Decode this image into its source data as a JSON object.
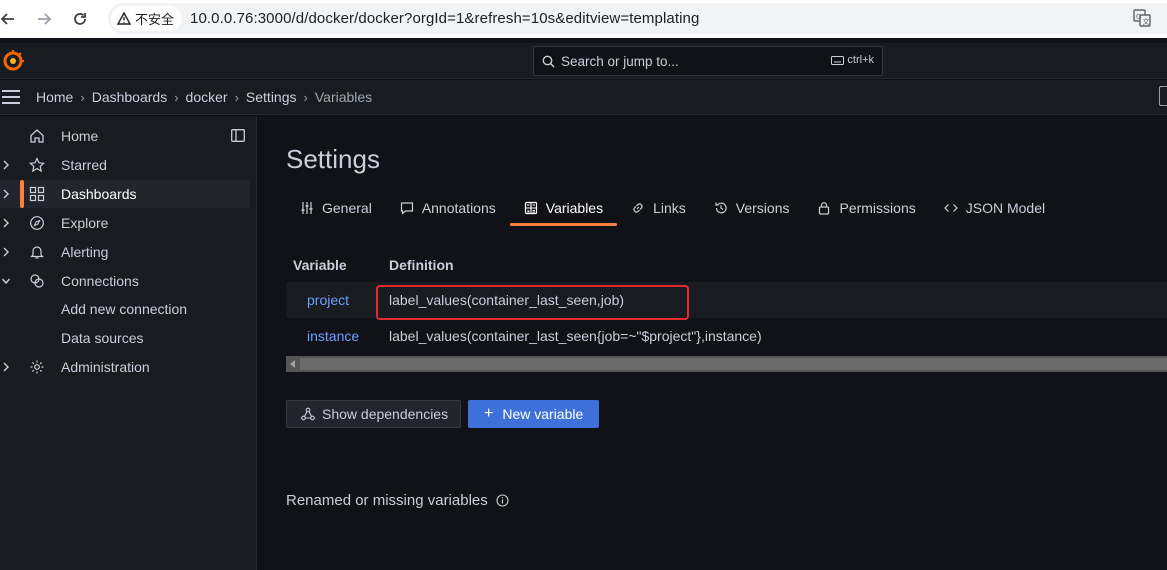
{
  "browser": {
    "security_label": "不安全",
    "url": "10.0.0.76:3000/d/docker/docker?orgId=1&refresh=10s&editview=templating"
  },
  "topbar": {
    "search_placeholder": "Search or jump to...",
    "shortcut": "ctrl+k"
  },
  "breadcrumb": {
    "items": [
      "Home",
      "Dashboards",
      "docker",
      "Settings",
      "Variables"
    ]
  },
  "sidebar": {
    "items": [
      {
        "label": "Home",
        "icon": "home-icon"
      },
      {
        "label": "Starred",
        "icon": "star-icon"
      },
      {
        "label": "Dashboards",
        "icon": "apps-icon"
      },
      {
        "label": "Explore",
        "icon": "compass-icon"
      },
      {
        "label": "Alerting",
        "icon": "bell-icon"
      },
      {
        "label": "Connections",
        "icon": "link-icon"
      },
      {
        "label": "Add new connection"
      },
      {
        "label": "Data sources"
      },
      {
        "label": "Administration",
        "icon": "cog-icon"
      }
    ]
  },
  "page": {
    "title": "Settings",
    "tabs": [
      {
        "label": "General",
        "icon": "sliders-icon"
      },
      {
        "label": "Annotations",
        "icon": "comment-icon"
      },
      {
        "label": "Variables",
        "icon": "calculator-icon"
      },
      {
        "label": "Links",
        "icon": "link-icon"
      },
      {
        "label": "Versions",
        "icon": "history-icon"
      },
      {
        "label": "Permissions",
        "icon": "lock-icon"
      },
      {
        "label": "JSON Model",
        "icon": "code-icon"
      }
    ],
    "table": {
      "headers": [
        "Variable",
        "Definition"
      ],
      "rows": [
        {
          "name": "project",
          "definition": "label_values(container_last_seen,job)"
        },
        {
          "name": "instance",
          "definition": "label_values(container_last_seen{job=~\"$project\"},instance)"
        }
      ]
    },
    "show_dependencies_label": "Show dependencies",
    "new_variable_label": "New variable",
    "renamed_section_title": "Renamed or missing variables"
  },
  "colors": {
    "accent": "#ff7f3f",
    "primary": "#3d71d9",
    "link": "#6e9fff",
    "highlight": "#e52b2b"
  }
}
